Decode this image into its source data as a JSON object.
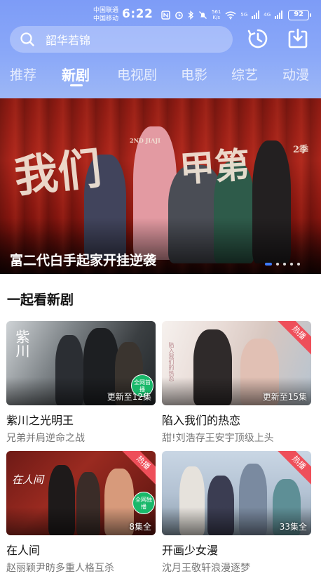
{
  "status_bar": {
    "carrier_1": "中国联通",
    "carrier_2": "中国移动",
    "time": "6:22",
    "speed": "561",
    "speed_unit": "K/s",
    "network_5g": "5G",
    "network_4g": "4G",
    "battery": "92"
  },
  "search": {
    "text": "韶华若锦"
  },
  "icons": {
    "search": "search-icon",
    "history": "history-icon",
    "download": "download-icon"
  },
  "tabs": [
    {
      "label": "推荐",
      "active": false
    },
    {
      "label": "新剧",
      "active": true
    },
    {
      "label": "电视剧",
      "active": false
    },
    {
      "label": "电影",
      "active": false
    },
    {
      "label": "综艺",
      "active": false
    },
    {
      "label": "动漫",
      "active": false
    }
  ],
  "banner": {
    "poster_text_1": "我们",
    "poster_text_2": "甲第",
    "poster_text_3": "2ND JIAJI",
    "poster_text_4": "2季",
    "caption": "富二代白手起家开挂逆袭",
    "dot_count": 5,
    "active_dot": 0
  },
  "section": {
    "title": "一起看新剧"
  },
  "cards": [
    {
      "title": "紫川之光明王",
      "subtitle": "兄弟并肩逆命之战",
      "overlay": "更新至12集",
      "poster_text": "紫川",
      "badge": "全网首播",
      "ribbon": ""
    },
    {
      "title": "陷入我们的热恋",
      "subtitle": "甜!刘浩存王安宇顶级上头",
      "overlay": "更新至15集",
      "poster_text": "陷入我们的热恋",
      "badge": "",
      "ribbon": "热播"
    },
    {
      "title": "在人间",
      "subtitle": "赵丽颖尹昉多重人格互杀",
      "overlay": "8集全",
      "poster_text": "在人间",
      "badge": "全网独播",
      "ribbon": "热播"
    },
    {
      "title": "开画少女漫",
      "subtitle": "沈月王敬轩浪漫逐梦",
      "overlay": "33集全",
      "poster_text": "",
      "badge": "",
      "ribbon": "热播"
    }
  ],
  "colors": {
    "accent": "#3d7bff",
    "header_top": "#7d9cf7",
    "ribbon": "#ee4f5a",
    "badge": "#19b86a"
  }
}
